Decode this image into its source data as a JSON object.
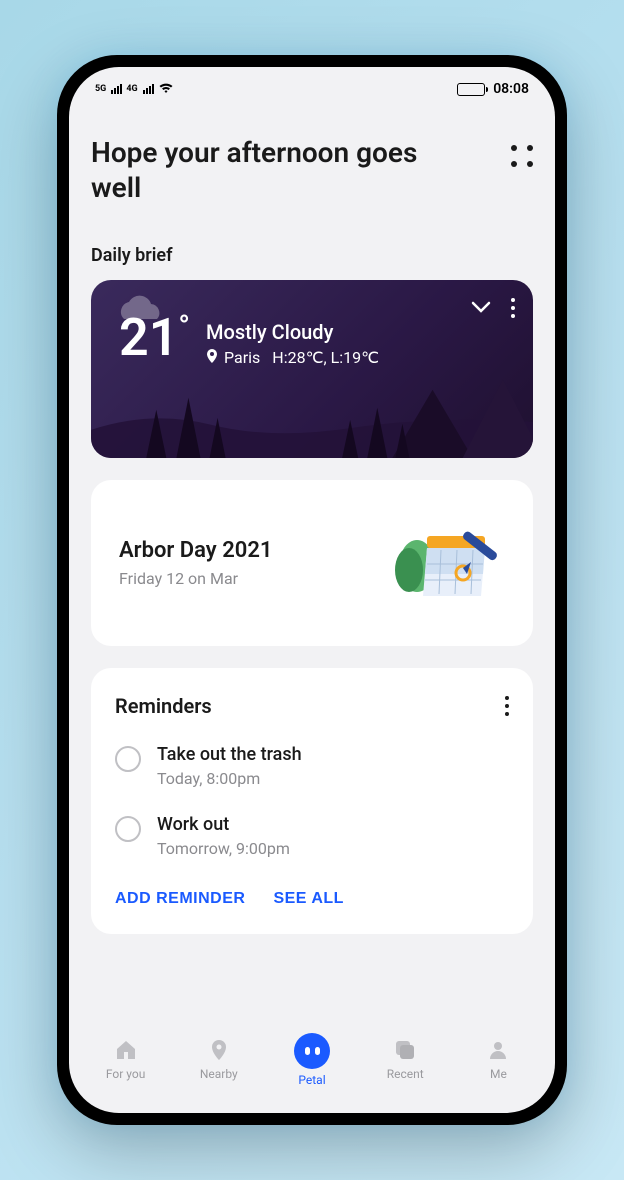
{
  "status": {
    "signal1_label": "5G",
    "signal2_label": "4G",
    "time": "08:08"
  },
  "header": {
    "greeting": "Hope your afternoon goes well"
  },
  "daily_brief": {
    "label": "Daily brief"
  },
  "weather": {
    "temp": "21",
    "degree": "°",
    "condition": "Mostly Cloudy",
    "location": "Paris",
    "hilow": "H:28℃, L:19℃"
  },
  "event": {
    "title": "Arbor Day 2021",
    "subtitle": "Friday 12 on Mar"
  },
  "reminders": {
    "title": "Reminders",
    "items": [
      {
        "text": "Take out the trash",
        "time": "Today, 8:00pm"
      },
      {
        "text": "Work out",
        "time": "Tomorrow, 9:00pm"
      }
    ],
    "add_label": "ADD REMINDER",
    "see_all_label": "SEE ALL"
  },
  "nav": {
    "items": [
      {
        "label": "For you"
      },
      {
        "label": "Nearby"
      },
      {
        "label": "Petal"
      },
      {
        "label": "Recent"
      },
      {
        "label": "Me"
      }
    ]
  }
}
